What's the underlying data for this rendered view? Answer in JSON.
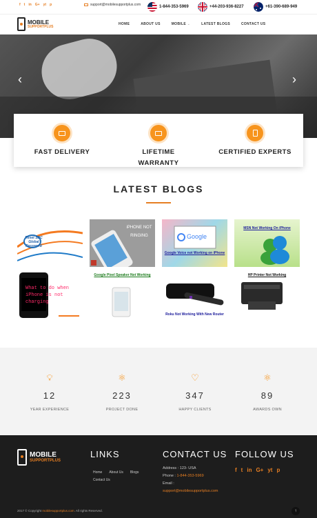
{
  "topbar": {
    "social": [
      "f",
      "t",
      "in",
      "G+",
      "yt",
      "p"
    ],
    "email": "support@mobilesupportplus.com",
    "phones": [
      {
        "number": "1-844-353-5969",
        "flag": "US"
      },
      {
        "number": "+44-203-936-8227",
        "flag": "UK"
      },
      {
        "number": "+61-390-689-949",
        "flag": "AU"
      }
    ]
  },
  "brand": {
    "line1": "MOBILE",
    "line2": "SUPPORTPLUS"
  },
  "nav": {
    "home": "HOME",
    "about": "ABOUT US",
    "mobile": "MOBILE",
    "blogs": "LATEST BLOGS",
    "contact": "CONTACT US"
  },
  "features": [
    {
      "icon": "monitor-icon",
      "label": "FAST DELIVERY"
    },
    {
      "icon": "monitor-icon",
      "label": "LIFETIME WARRANTY"
    },
    {
      "icon": "phone-icon",
      "label": "CERTIFIED EXPERTS"
    }
  ],
  "blogs": {
    "title": "LATEST BLOGS",
    "items": [
      {
        "caption": "Reset SBC Global Password"
      },
      {
        "caption": "iPHONE NOT RINGING"
      },
      {
        "caption": "Google Voice not Working on iPhone"
      },
      {
        "caption": "MSN Not Working On iPhone"
      },
      {
        "caption": "What to do when iPhone is not charging"
      },
      {
        "caption": "Google Pixel Speaker Not Working"
      },
      {
        "caption": "Roku Not Working With New Router"
      },
      {
        "caption": "HP Printer Not Working"
      }
    ]
  },
  "stats": [
    {
      "icon": "bulb-icon",
      "number": "12",
      "label": "YEAR EXPERIENCE"
    },
    {
      "icon": "atom-icon",
      "number": "223",
      "label": "PROJECT DONE"
    },
    {
      "icon": "heart-icon",
      "number": "347",
      "label": "HAPPY CLIENTS"
    },
    {
      "icon": "atom-icon",
      "number": "89",
      "label": "AWARDS OWN"
    }
  ],
  "footer": {
    "links_title": "LINKS",
    "links": [
      "Home",
      "About Us",
      "Blogs",
      "Contact Us"
    ],
    "contact_title": "CONTACT US",
    "address": "Address : 123- USA",
    "phone_label": "Phone : ",
    "phone": "1-844-353-5969",
    "email_label": "Email :",
    "email": "support@mobilesupportplus.com",
    "follow_title": "FOLLOW US",
    "social": [
      "f",
      "t",
      "in",
      "G+",
      "yt",
      "p"
    ],
    "copyright_prefix": "2017 © Copyright",
    "copyright_site": "mobilesupportplus.com",
    "copyright_suffix": ". All rights Reserved.",
    "to_top": "↑"
  },
  "colors": {
    "accent": "#f7941d",
    "footer_bg": "#1d1d1d"
  }
}
